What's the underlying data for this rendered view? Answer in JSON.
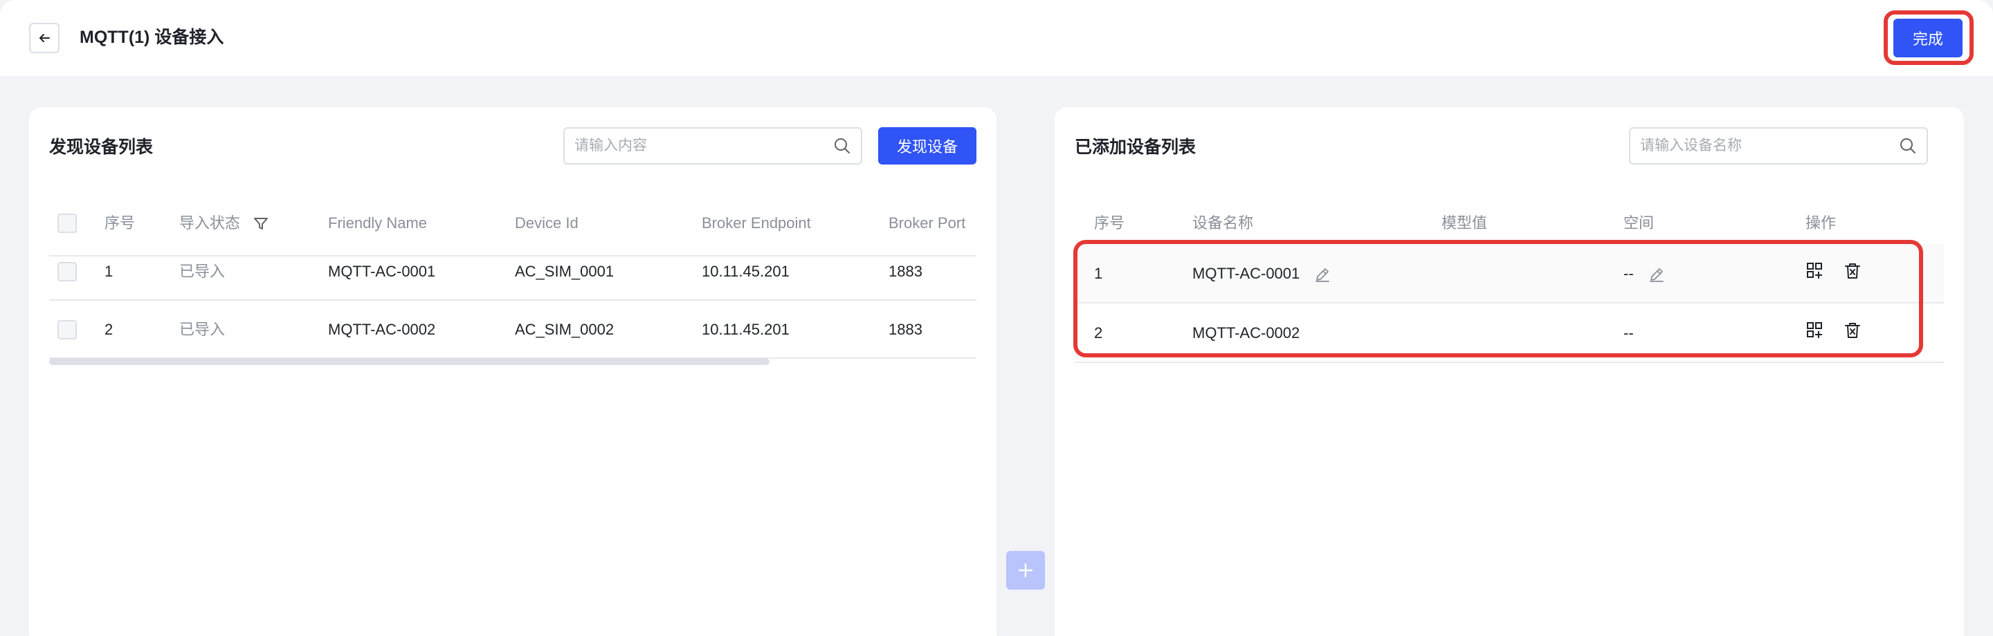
{
  "header": {
    "title": "MQTT(1) 设备接入",
    "done_label": "完成"
  },
  "left_panel": {
    "title": "发现设备列表",
    "search_placeholder": "请输入内容",
    "discover_label": "发现设备",
    "columns": [
      "序号",
      "导入状态",
      "Friendly Name",
      "Device Id",
      "Broker Endpoint",
      "Broker Port"
    ],
    "rows": [
      {
        "index": "1",
        "status": "已导入",
        "friendly_name": "MQTT-AC-0001",
        "device_id": "AC_SIM_0001",
        "endpoint": "10.11.45.201",
        "port": "1883"
      },
      {
        "index": "2",
        "status": "已导入",
        "friendly_name": "MQTT-AC-0002",
        "device_id": "AC_SIM_0002",
        "endpoint": "10.11.45.201",
        "port": "1883"
      }
    ]
  },
  "right_panel": {
    "title": "已添加设备列表",
    "search_placeholder": "请输入设备名称",
    "columns": [
      "序号",
      "设备名称",
      "模型值",
      "空间",
      "操作"
    ],
    "rows": [
      {
        "index": "1",
        "name": "MQTT-AC-0001",
        "model": "",
        "space": "--"
      },
      {
        "index": "2",
        "name": "MQTT-AC-0002",
        "model": "",
        "space": "--"
      }
    ]
  },
  "colors": {
    "primary": "#3054f5",
    "highlight": "#e53935",
    "disabled_primary": "#b8c4fb"
  }
}
